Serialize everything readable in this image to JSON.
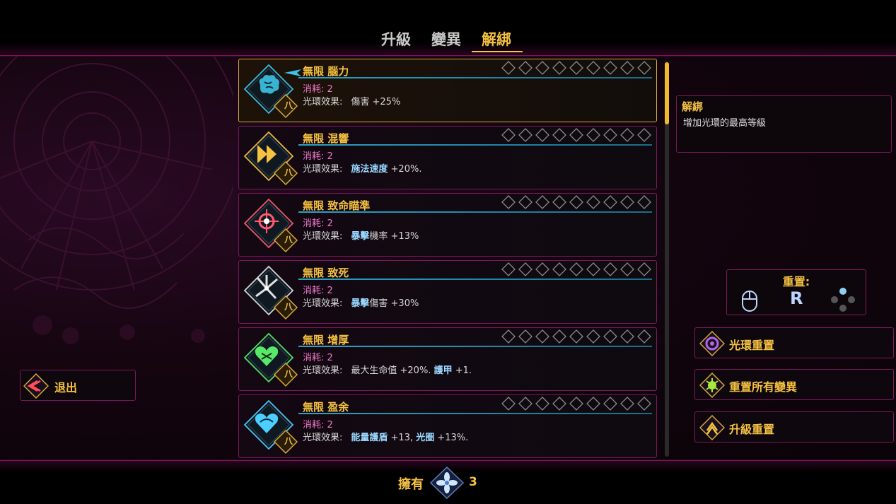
{
  "tabs": [
    {
      "label": "升級",
      "active": false
    },
    {
      "label": "變異",
      "active": false
    },
    {
      "label": "解綁",
      "active": true
    }
  ],
  "upgrades": [
    {
      "name": "無限 腦力",
      "cost": "消耗: 2",
      "effect_prefix": "光環效果:",
      "effect_parts": [
        [
          "",
          "傷害 +25%"
        ]
      ],
      "icon": "brain-icon",
      "color": "#3fc3e6",
      "selected": true
    },
    {
      "name": "無限 混響",
      "cost": "消耗: 2",
      "effect_prefix": "光環效果:",
      "effect_parts": [
        [
          "施法速度",
          " +20%."
        ]
      ],
      "icon": "fast-forward-icon",
      "color": "#f5c242",
      "selected": false
    },
    {
      "name": "無限 致命瞄準",
      "cost": "消耗: 2",
      "effect_prefix": "光環效果:",
      "effect_parts": [
        [
          "暴擊",
          "機率 +13%"
        ]
      ],
      "icon": "crosshair-star-icon",
      "color": "#ff5a6e",
      "selected": false
    },
    {
      "name": "無限 致死",
      "cost": "消耗: 2",
      "effect_prefix": "光環效果:",
      "effect_parts": [
        [
          "暴擊",
          "傷害 +30%"
        ]
      ],
      "icon": "blades-icon",
      "color": "#e0e0e0",
      "selected": false
    },
    {
      "name": "無限 增厚",
      "cost": "消耗: 2",
      "effect_prefix": "光環效果:",
      "effect_parts": [
        [
          "",
          "最大生命值 +20%. "
        ],
        [
          "護甲",
          " +1."
        ]
      ],
      "icon": "green-heart-icon",
      "color": "#58e86a",
      "selected": false
    },
    {
      "name": "無限 盈余",
      "cost": "消耗: 2",
      "effect_prefix": "光環效果:",
      "effect_parts": [
        [
          "能量護盾",
          " +13, "
        ],
        [
          "光圈",
          " +13%."
        ]
      ],
      "icon": "blue-heart-icon",
      "color": "#4ccfff",
      "selected": false
    }
  ],
  "rank_badge": "八",
  "info": {
    "title": "解綁",
    "desc": "增加光環的最高等級"
  },
  "reset": {
    "title": "重置:",
    "key": "R"
  },
  "actions": {
    "aura_reset": "光環重置",
    "reset_mutations": "重置所有變異",
    "upgrade_reset": "升級重置"
  },
  "exit": "退出",
  "owned": {
    "label": "擁有",
    "count": "3"
  },
  "colors": {
    "accent": "#f5c242",
    "border": "#7a1a5c",
    "line": "#2aa3c7"
  }
}
